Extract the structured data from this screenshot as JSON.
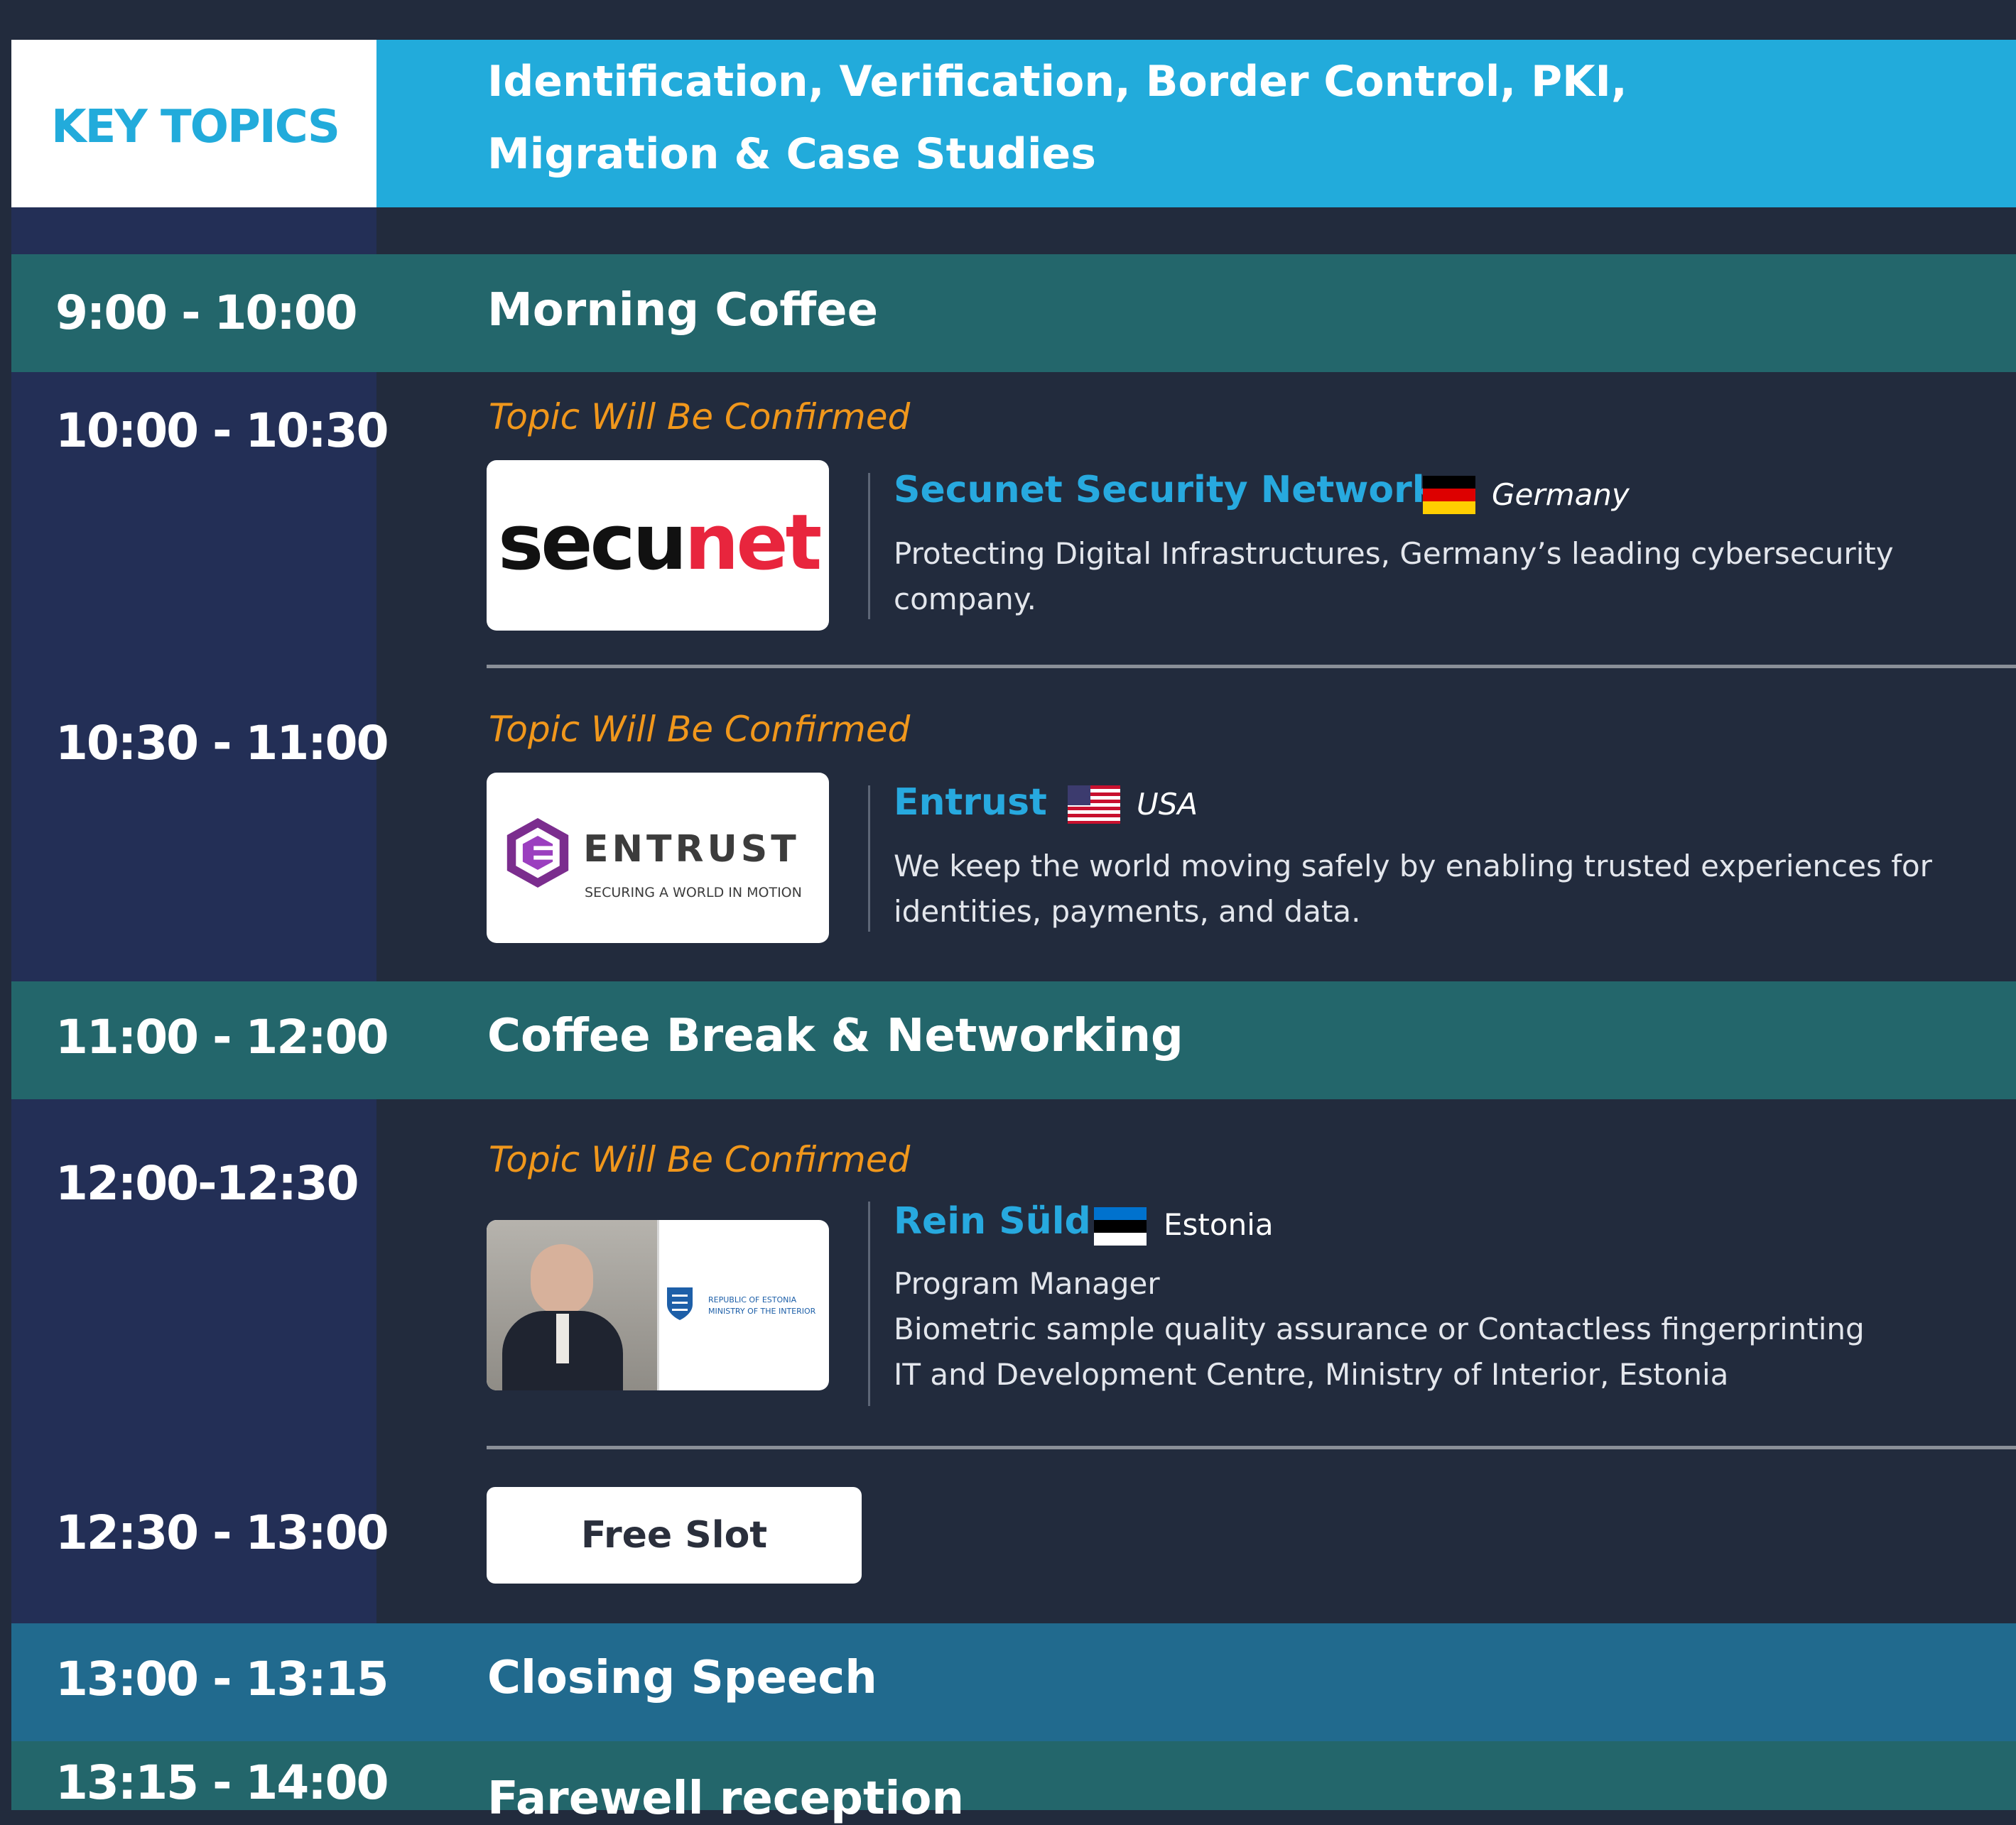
{
  "key_topics": {
    "label": "KEY TOPICS",
    "line1": "Identification, Verification, Border Control, PKI,",
    "line2": "Migration & Case Studies"
  },
  "colors": {
    "page_bg": "#222b3d",
    "time_column": "#232f56",
    "topics_bar": "#22abdb",
    "break_band": "#23666b",
    "closing_band": "#216a8e",
    "topic_orange": "#f0971c",
    "speaker_blue": "#27a9df"
  },
  "schedule": {
    "morning_coffee": {
      "time": "9:00 - 10:00",
      "title": "Morning Coffee"
    },
    "session1": {
      "time": "10:00 - 10:30",
      "topic": "Topic Will Be Confirmed",
      "speaker": "Secunet Security Networks",
      "country": "Germany",
      "logo": {
        "part1": "secu",
        "part2": "net"
      },
      "description": "Protecting Digital Infrastructures, Germany’s leading cybersecurity company."
    },
    "session2": {
      "time": "10:30 - 11:00",
      "topic": "Topic Will Be Confirmed",
      "speaker": "Entrust",
      "country": "USA",
      "logo": {
        "name": "ENTRUST",
        "tagline": "SECURING A WORLD IN MOTION"
      },
      "description": "We keep the world moving safely by enabling trusted experiences for identities, payments, and data."
    },
    "coffee_break": {
      "time": "11:00 - 12:00",
      "title": "Coffee Break & Networking"
    },
    "session3": {
      "time": "12:00-12:30",
      "topic": "Topic Will Be Confirmed",
      "speaker": "Rein Süld",
      "country": "Estonia",
      "logo": {
        "line1": "Republic of Estonia",
        "line2": "Ministry of the Interior"
      },
      "role": "Program Manager",
      "line2": "Biometric sample quality assurance or Contactless fingerprinting",
      "line3": "IT and Development Centre, Ministry of Interior, Estonia"
    },
    "session4": {
      "time": "12:30 - 13:00",
      "button": "Free Slot"
    },
    "closing": {
      "time": "13:00 - 13:15",
      "title": "Closing Speech"
    },
    "farewell": {
      "time": "13:15 - 14:00",
      "title": "Farewell reception"
    }
  }
}
